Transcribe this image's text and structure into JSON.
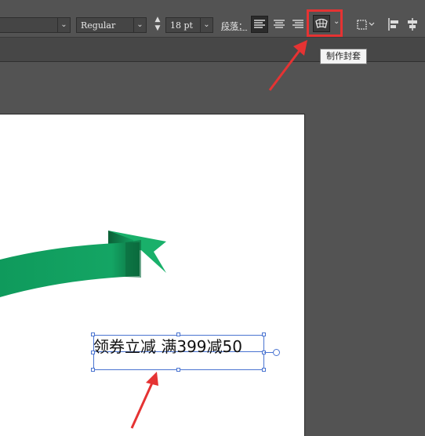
{
  "toolbar": {
    "font_style": "Regular",
    "font_size": "18 pt",
    "paragraph_label": "段落：",
    "tooltip": "制作封套"
  },
  "document": {
    "text_content": "领券立减 满399减50"
  },
  "colors": {
    "ribbon_green": "#0f9a5c",
    "highlight_red": "#e53333",
    "selection_blue": "#4a74d1"
  }
}
